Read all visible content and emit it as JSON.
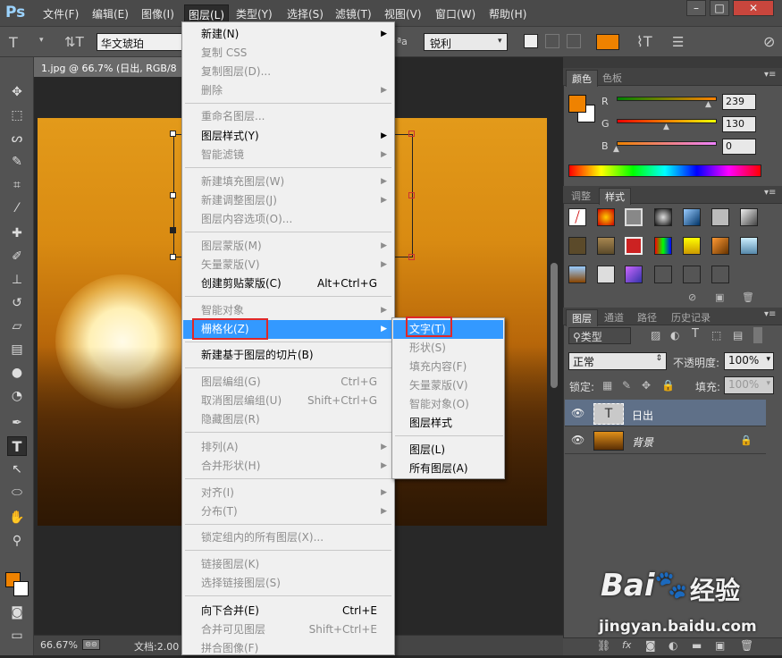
{
  "app": {
    "logo": "Ps"
  },
  "menubar": {
    "items": [
      "文件(F)",
      "编辑(E)",
      "图像(I)",
      "图层(L)",
      "类型(Y)",
      "选择(S)",
      "滤镜(T)",
      "视图(V)",
      "窗口(W)",
      "帮助(H)"
    ],
    "active": "图层(L)"
  },
  "options_bar": {
    "font_family": "华文琥珀",
    "antialias": "锐利",
    "text_color": "#ef8200",
    "aa_label": "ªa"
  },
  "document": {
    "tab_title": "1.jpg @ 66.7% (日出, RGB/8"
  },
  "status": {
    "zoom": "66.67%",
    "doc_info": "文档:2.00"
  },
  "layer_menu": {
    "items": [
      {
        "label": "新建(N)",
        "disabled": false,
        "submenu": true
      },
      {
        "label": "复制 CSS",
        "disabled": true
      },
      {
        "label": "复制图层(D)...",
        "disabled": true
      },
      {
        "label": "删除",
        "disabled": true,
        "submenu": true
      },
      {
        "label": "重命名图层...",
        "disabled": true
      },
      {
        "label": "图层样式(Y)",
        "disabled": false,
        "submenu": true
      },
      {
        "label": "智能滤镜",
        "disabled": true,
        "submenu": true
      },
      {
        "label": "新建填充图层(W)",
        "disabled": true,
        "submenu": true
      },
      {
        "label": "新建调整图层(J)",
        "disabled": true,
        "submenu": true
      },
      {
        "label": "图层内容选项(O)...",
        "disabled": true
      },
      {
        "label": "图层蒙版(M)",
        "disabled": true,
        "submenu": true
      },
      {
        "label": "矢量蒙版(V)",
        "disabled": true,
        "submenu": true
      },
      {
        "label": "创建剪贴蒙版(C)",
        "shortcut": "Alt+Ctrl+G",
        "disabled": false
      },
      {
        "label": "智能对象",
        "disabled": true,
        "submenu": true
      },
      {
        "label": "栅格化(Z)",
        "disabled": false,
        "submenu": true,
        "highlighted": true
      },
      {
        "label": "新建基于图层的切片(B)",
        "disabled": false
      },
      {
        "label": "图层编组(G)",
        "shortcut": "Ctrl+G",
        "disabled": true
      },
      {
        "label": "取消图层编组(U)",
        "shortcut": "Shift+Ctrl+G",
        "disabled": true
      },
      {
        "label": "隐藏图层(R)",
        "disabled": true
      },
      {
        "label": "排列(A)",
        "disabled": true,
        "submenu": true
      },
      {
        "label": "合并形状(H)",
        "disabled": true,
        "submenu": true
      },
      {
        "label": "对齐(I)",
        "disabled": true,
        "submenu": true
      },
      {
        "label": "分布(T)",
        "disabled": true,
        "submenu": true
      },
      {
        "label": "锁定组内的所有图层(X)...",
        "disabled": true
      },
      {
        "label": "链接图层(K)",
        "disabled": true
      },
      {
        "label": "选择链接图层(S)",
        "disabled": true
      },
      {
        "label": "向下合并(E)",
        "shortcut": "Ctrl+E",
        "disabled": false
      },
      {
        "label": "合并可见图层",
        "shortcut": "Shift+Ctrl+E",
        "disabled": true
      },
      {
        "label": "拼合图像(F)",
        "disabled": true
      }
    ]
  },
  "rasterize_menu": {
    "items": [
      {
        "label": "文字(T)",
        "disabled": false,
        "highlighted": true
      },
      {
        "label": "形状(S)",
        "disabled": true
      },
      {
        "label": "填充内容(F)",
        "disabled": true
      },
      {
        "label": "矢量蒙版(V)",
        "disabled": true
      },
      {
        "label": "智能对象(O)",
        "disabled": true
      },
      {
        "label": "图层样式",
        "disabled": false
      },
      {
        "label": "图层(L)",
        "disabled": false
      },
      {
        "label": "所有图层(A)",
        "disabled": false
      }
    ]
  },
  "color_panel": {
    "tabs": [
      "颜色",
      "色板"
    ],
    "r_label": "R",
    "g_label": "G",
    "b_label": "B",
    "r": "239",
    "g": "130",
    "b": "0",
    "fg_color": "#ef8200"
  },
  "styles_panel": {
    "tabs": [
      "调整",
      "样式"
    ]
  },
  "layers_panel": {
    "tabs": [
      "图层",
      "通道",
      "路径",
      "历史记录"
    ],
    "filter_kind": "类型",
    "blend_mode": "正常",
    "opacity_label": "不透明度:",
    "opacity": "100%",
    "lock_label": "锁定:",
    "fill_label": "填充:",
    "fill": "100%",
    "layers": [
      {
        "name": "日出",
        "type": "text",
        "selected": true
      },
      {
        "name": "背景",
        "type": "image",
        "locked": true
      }
    ]
  },
  "watermark": {
    "brand": "Bai",
    "brand2": "经验",
    "url": "jingyan.baidu.com"
  }
}
